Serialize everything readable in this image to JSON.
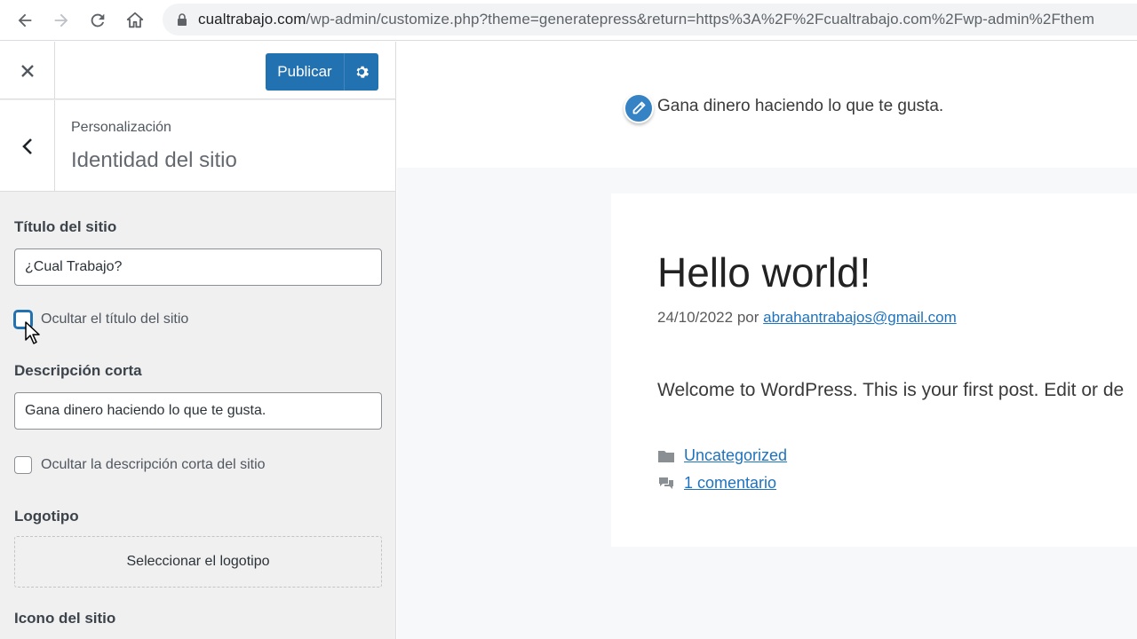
{
  "browser": {
    "url_host": "cualtrabajo.com",
    "url_path": "/wp-admin/customize.php?theme=generatepress&return=https%3A%2F%2Fcualtrabajo.com%2Fwp-admin%2Fthem"
  },
  "customizer": {
    "publish_label": "Publicar",
    "breadcrumb": "Personalización",
    "section_title": "Identidad del sitio",
    "site_title_label": "Título del sitio",
    "site_title_value": "¿Cual Trabajo?",
    "hide_title_label": "Ocultar el título del sitio",
    "tagline_label": "Descripción corta",
    "tagline_value": "Gana dinero haciendo lo que te gusta.",
    "hide_tagline_label": "Ocultar la descripción corta del sitio",
    "logo_label": "Logotipo",
    "logo_button": "Seleccionar el logotipo",
    "site_icon_label": "Icono del sitio"
  },
  "preview": {
    "tagline": "Gana dinero haciendo lo que te gusta.",
    "post_title": "Hello world!",
    "post_date": "24/10/2022",
    "post_by": "por",
    "post_author": "abrahantrabajos@gmail.com",
    "post_excerpt": "Welcome to WordPress. This is your first post. Edit or de",
    "category": "Uncategorized",
    "comments": "1 comentario"
  },
  "colors": {
    "accent": "#2271b1",
    "link": "#1e73be",
    "sidebar_bg": "#f0f0f1"
  },
  "icons": [
    "back-arrow-icon",
    "forward-arrow-icon",
    "reload-icon",
    "home-icon",
    "lock-icon",
    "close-icon",
    "gear-icon",
    "chevron-left-icon",
    "pencil-icon",
    "folder-icon",
    "comments-icon",
    "cursor-icon"
  ]
}
